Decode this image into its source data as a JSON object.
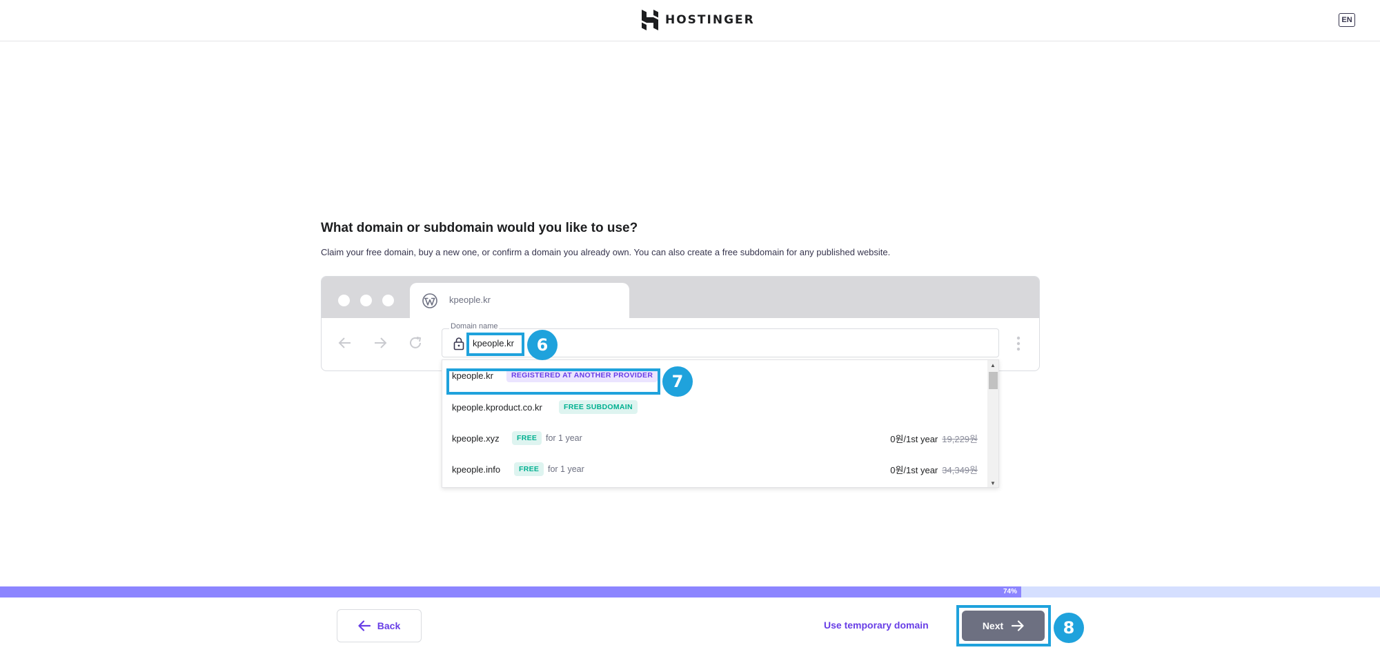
{
  "header": {
    "brand": "HOSTINGER",
    "language": "EN"
  },
  "main": {
    "title": "What domain or subdomain would you like to use?",
    "subtitle": "Claim your free domain, buy a new one, or confirm a domain you already own. You can also create a free subdomain for any published website.",
    "browser_tab_label": "kpeople.kr",
    "domain_field": {
      "label": "Domain name",
      "value": "kpeople.kr"
    },
    "suggestions": [
      {
        "name": "kpeople.kr",
        "badge": "REGISTERED AT ANOTHER PROVIDER",
        "badge_type": "purple"
      },
      {
        "name": "kpeople.kproduct.co.kr",
        "badge": "FREE SUBDOMAIN",
        "badge_type": "green"
      },
      {
        "name": "kpeople.xyz",
        "badge": "FREE",
        "badge_type": "green",
        "note": "for 1 year",
        "price": "0원/1st year",
        "old_price": "19,229원"
      },
      {
        "name": "kpeople.info",
        "badge": "FREE",
        "badge_type": "green",
        "note": "for 1 year",
        "price": "0원/1st year",
        "old_price": "34,349원"
      }
    ]
  },
  "annotations": {
    "step_6": "6",
    "step_7": "7",
    "step_8": "8",
    "color": "#1fa2dc"
  },
  "progress": {
    "value": 0.74,
    "label": "74%"
  },
  "footer": {
    "back_label": "Back",
    "temporary_domain_label": "Use temporary domain",
    "next_label": "Next"
  },
  "colors": {
    "accent": "#673de6",
    "progress_fill": "#8c85ff",
    "progress_track": "#d5dfff",
    "next_button": "#6d7081",
    "annotation": "#1fa2dc"
  }
}
